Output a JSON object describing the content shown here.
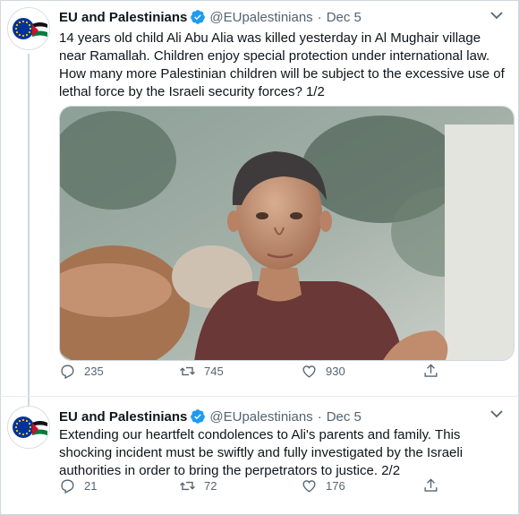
{
  "tweets": [
    {
      "author_name": "EU and Palestinians",
      "handle": "@EUpalestinians",
      "separator": "·",
      "date": "Dec 5",
      "text": "14 years old child Ali Abu Alia was killed yesterday in Al Mughair village near Ramallah. Children enjoy special protection under international law. How many more  Palestinian children will be subject to the excessive use of lethal force by the Israeli security forces? 1/2",
      "replies": "235",
      "retweets": "745",
      "likes": "930"
    },
    {
      "author_name": "EU and Palestinians",
      "handle": "@EUpalestinians",
      "separator": "·",
      "date": "Dec 5",
      "text": "Extending our heartfelt condolences to Ali's parents and family. This shocking incident must be swiftly and fully investigated by the Israeli authorities in order to bring the perpetrators to justice. 2/2",
      "replies": "21",
      "retweets": "72",
      "likes": "176"
    }
  ],
  "icons": {
    "reply": "reply-icon",
    "retweet": "retweet-icon",
    "like": "heart-icon",
    "share": "share-icon",
    "verified": "verified-badge-icon",
    "more": "chevron-down-icon"
  },
  "colors": {
    "verified_blue": "#1d9bf0",
    "eu_blue": "#003399",
    "eu_star": "#ffcc00",
    "palestine_red": "#ce1126",
    "palestine_green": "#007a3d",
    "muted_text": "#536471"
  }
}
